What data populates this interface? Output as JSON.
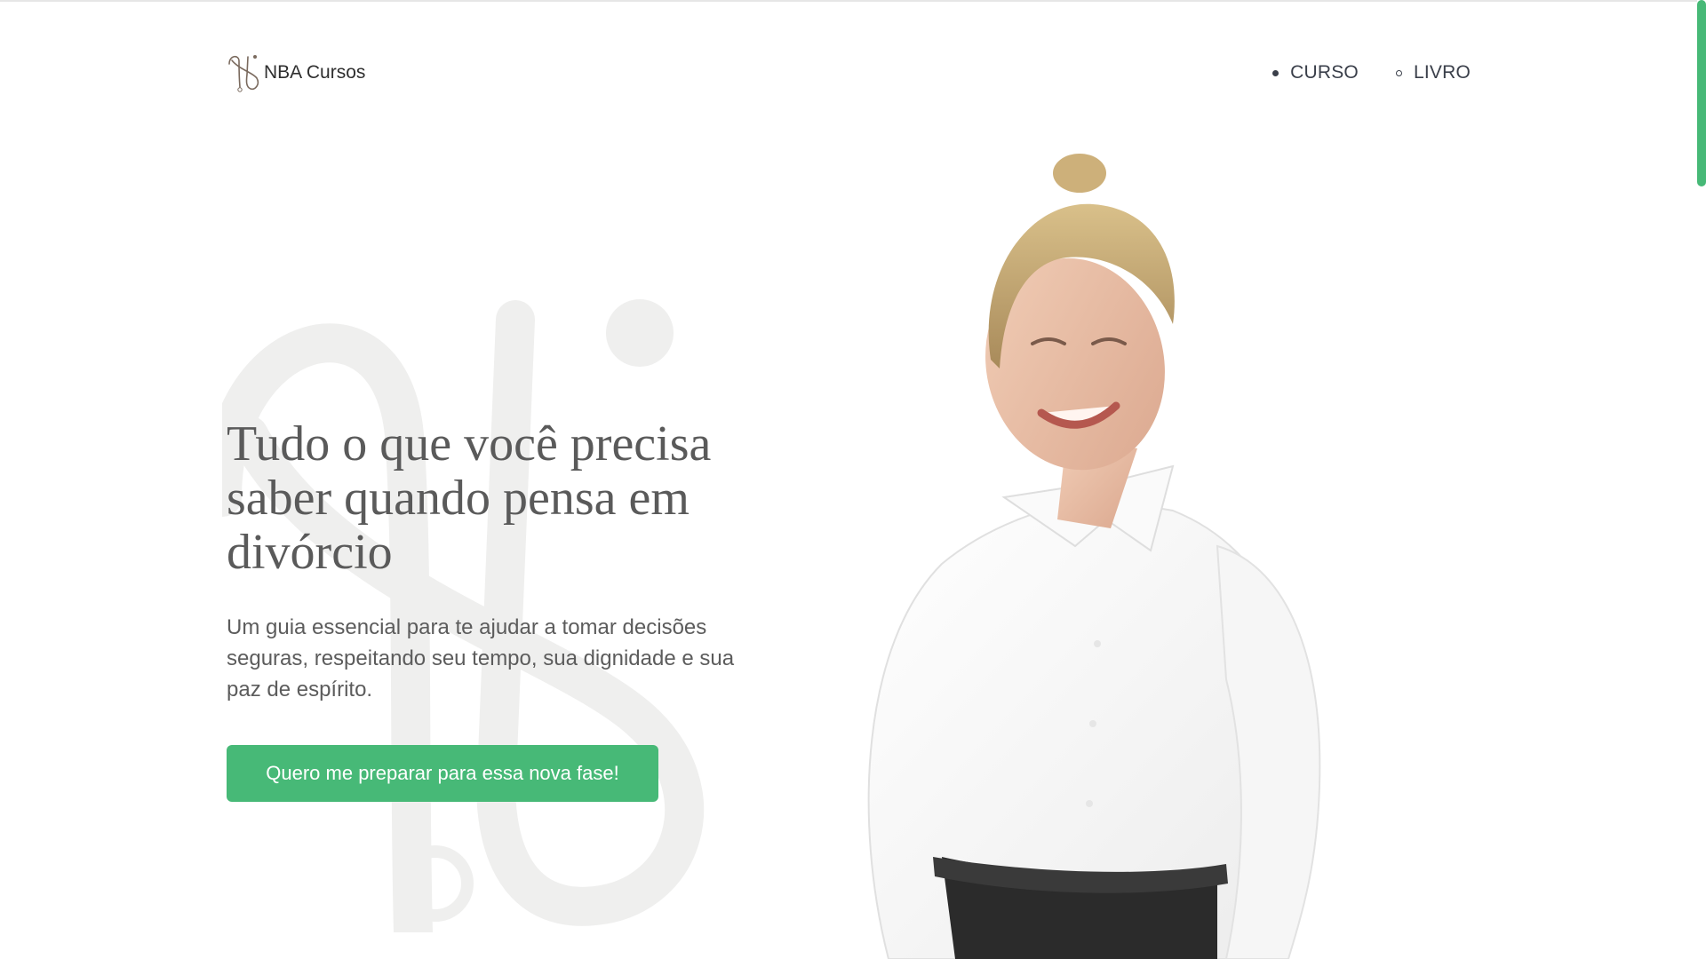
{
  "brand": {
    "name": "NBA Cursos"
  },
  "nav": {
    "items": [
      {
        "label": "CURSO",
        "active": true
      },
      {
        "label": "LIVRO",
        "active": false
      }
    ]
  },
  "hero": {
    "title": "Tudo o que você precisa saber quando pensa em divórcio",
    "subtitle": "Um guia essencial para te ajudar a tomar decisões seguras, respeitando seu tempo, sua dignidade e sua paz de espírito.",
    "cta_label": "Quero me preparar para essa nova fase!"
  },
  "colors": {
    "accent": "#47b977",
    "text": "#5a5a5a",
    "watermark": "#efefee"
  },
  "icons": {
    "logo": "nb-monogram-icon",
    "nav_active": "filled-dot-icon",
    "nav_inactive": "hollow-dot-icon"
  }
}
